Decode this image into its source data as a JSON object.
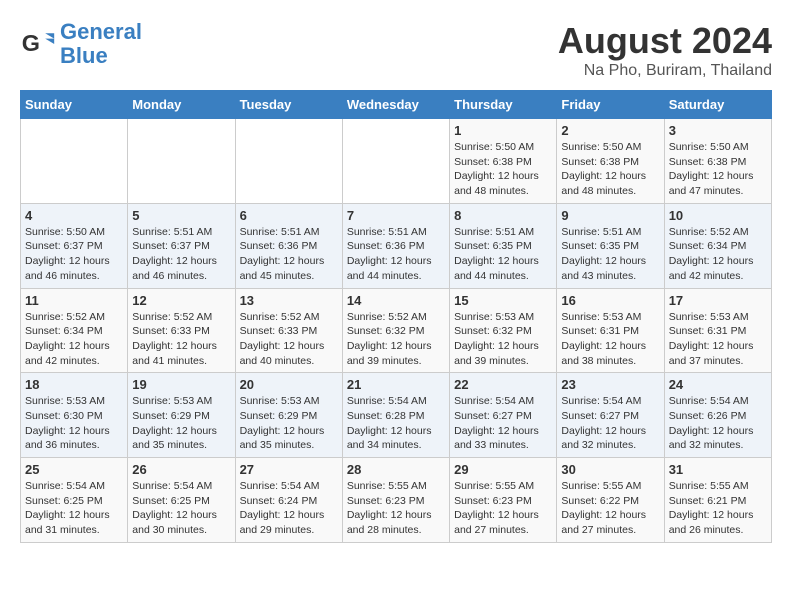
{
  "header": {
    "logo_line1": "General",
    "logo_line2": "Blue",
    "title": "August 2024",
    "subtitle": "Na Pho, Buriram, Thailand"
  },
  "days_of_week": [
    "Sunday",
    "Monday",
    "Tuesday",
    "Wednesday",
    "Thursday",
    "Friday",
    "Saturday"
  ],
  "weeks": [
    [
      {
        "day": "",
        "info": ""
      },
      {
        "day": "",
        "info": ""
      },
      {
        "day": "",
        "info": ""
      },
      {
        "day": "",
        "info": ""
      },
      {
        "day": "1",
        "info": "Sunrise: 5:50 AM\nSunset: 6:38 PM\nDaylight: 12 hours\nand 48 minutes."
      },
      {
        "day": "2",
        "info": "Sunrise: 5:50 AM\nSunset: 6:38 PM\nDaylight: 12 hours\nand 48 minutes."
      },
      {
        "day": "3",
        "info": "Sunrise: 5:50 AM\nSunset: 6:38 PM\nDaylight: 12 hours\nand 47 minutes."
      }
    ],
    [
      {
        "day": "4",
        "info": "Sunrise: 5:50 AM\nSunset: 6:37 PM\nDaylight: 12 hours\nand 46 minutes."
      },
      {
        "day": "5",
        "info": "Sunrise: 5:51 AM\nSunset: 6:37 PM\nDaylight: 12 hours\nand 46 minutes."
      },
      {
        "day": "6",
        "info": "Sunrise: 5:51 AM\nSunset: 6:36 PM\nDaylight: 12 hours\nand 45 minutes."
      },
      {
        "day": "7",
        "info": "Sunrise: 5:51 AM\nSunset: 6:36 PM\nDaylight: 12 hours\nand 44 minutes."
      },
      {
        "day": "8",
        "info": "Sunrise: 5:51 AM\nSunset: 6:35 PM\nDaylight: 12 hours\nand 44 minutes."
      },
      {
        "day": "9",
        "info": "Sunrise: 5:51 AM\nSunset: 6:35 PM\nDaylight: 12 hours\nand 43 minutes."
      },
      {
        "day": "10",
        "info": "Sunrise: 5:52 AM\nSunset: 6:34 PM\nDaylight: 12 hours\nand 42 minutes."
      }
    ],
    [
      {
        "day": "11",
        "info": "Sunrise: 5:52 AM\nSunset: 6:34 PM\nDaylight: 12 hours\nand 42 minutes."
      },
      {
        "day": "12",
        "info": "Sunrise: 5:52 AM\nSunset: 6:33 PM\nDaylight: 12 hours\nand 41 minutes."
      },
      {
        "day": "13",
        "info": "Sunrise: 5:52 AM\nSunset: 6:33 PM\nDaylight: 12 hours\nand 40 minutes."
      },
      {
        "day": "14",
        "info": "Sunrise: 5:52 AM\nSunset: 6:32 PM\nDaylight: 12 hours\nand 39 minutes."
      },
      {
        "day": "15",
        "info": "Sunrise: 5:53 AM\nSunset: 6:32 PM\nDaylight: 12 hours\nand 39 minutes."
      },
      {
        "day": "16",
        "info": "Sunrise: 5:53 AM\nSunset: 6:31 PM\nDaylight: 12 hours\nand 38 minutes."
      },
      {
        "day": "17",
        "info": "Sunrise: 5:53 AM\nSunset: 6:31 PM\nDaylight: 12 hours\nand 37 minutes."
      }
    ],
    [
      {
        "day": "18",
        "info": "Sunrise: 5:53 AM\nSunset: 6:30 PM\nDaylight: 12 hours\nand 36 minutes."
      },
      {
        "day": "19",
        "info": "Sunrise: 5:53 AM\nSunset: 6:29 PM\nDaylight: 12 hours\nand 35 minutes."
      },
      {
        "day": "20",
        "info": "Sunrise: 5:53 AM\nSunset: 6:29 PM\nDaylight: 12 hours\nand 35 minutes."
      },
      {
        "day": "21",
        "info": "Sunrise: 5:54 AM\nSunset: 6:28 PM\nDaylight: 12 hours\nand 34 minutes."
      },
      {
        "day": "22",
        "info": "Sunrise: 5:54 AM\nSunset: 6:27 PM\nDaylight: 12 hours\nand 33 minutes."
      },
      {
        "day": "23",
        "info": "Sunrise: 5:54 AM\nSunset: 6:27 PM\nDaylight: 12 hours\nand 32 minutes."
      },
      {
        "day": "24",
        "info": "Sunrise: 5:54 AM\nSunset: 6:26 PM\nDaylight: 12 hours\nand 32 minutes."
      }
    ],
    [
      {
        "day": "25",
        "info": "Sunrise: 5:54 AM\nSunset: 6:25 PM\nDaylight: 12 hours\nand 31 minutes."
      },
      {
        "day": "26",
        "info": "Sunrise: 5:54 AM\nSunset: 6:25 PM\nDaylight: 12 hours\nand 30 minutes."
      },
      {
        "day": "27",
        "info": "Sunrise: 5:54 AM\nSunset: 6:24 PM\nDaylight: 12 hours\nand 29 minutes."
      },
      {
        "day": "28",
        "info": "Sunrise: 5:55 AM\nSunset: 6:23 PM\nDaylight: 12 hours\nand 28 minutes."
      },
      {
        "day": "29",
        "info": "Sunrise: 5:55 AM\nSunset: 6:23 PM\nDaylight: 12 hours\nand 27 minutes."
      },
      {
        "day": "30",
        "info": "Sunrise: 5:55 AM\nSunset: 6:22 PM\nDaylight: 12 hours\nand 27 minutes."
      },
      {
        "day": "31",
        "info": "Sunrise: 5:55 AM\nSunset: 6:21 PM\nDaylight: 12 hours\nand 26 minutes."
      }
    ]
  ]
}
